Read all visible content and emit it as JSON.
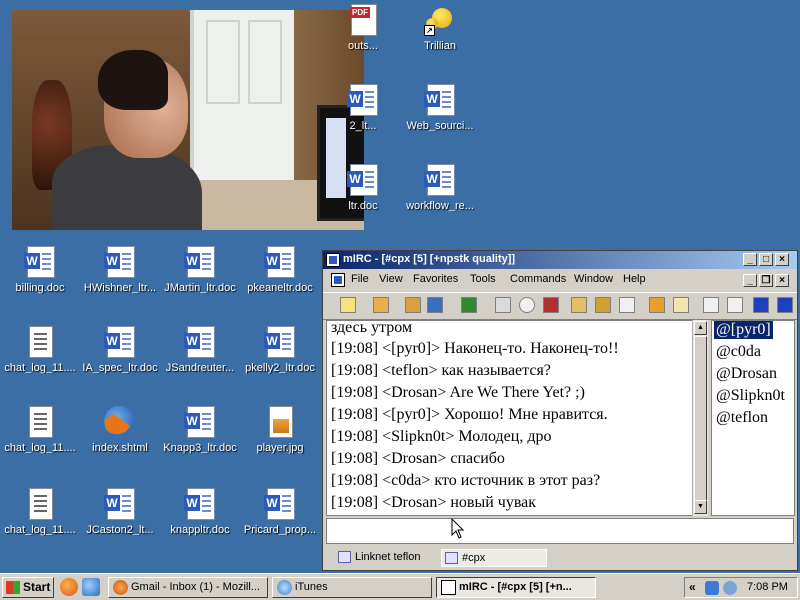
{
  "desktop": {
    "icons": [
      {
        "label": "outs...",
        "type": "pdf"
      },
      {
        "label": "Trillian",
        "type": "trillian"
      },
      {
        "label": "2_lt...",
        "type": "word"
      },
      {
        "label": "Web_sourci...",
        "type": "word"
      },
      {
        "label": "ltr.doc",
        "type": "word"
      },
      {
        "label": "workflow_re...",
        "type": "word"
      },
      {
        "label": "billing.doc",
        "type": "word"
      },
      {
        "label": "HWishner_ltr...",
        "type": "word"
      },
      {
        "label": "JMartin_ltr.doc",
        "type": "word"
      },
      {
        "label": "pkeaneltr.doc",
        "type": "word"
      },
      {
        "label": "chat_log_11....",
        "type": "txt"
      },
      {
        "label": "IA_spec_ltr.doc",
        "type": "word"
      },
      {
        "label": "JSandreuter...",
        "type": "word"
      },
      {
        "label": "pkelly2_ltr.doc",
        "type": "word"
      },
      {
        "label": "chat_log_11....",
        "type": "txt"
      },
      {
        "label": "index.shtml",
        "type": "firefox"
      },
      {
        "label": "Knapp3_ltr.doc",
        "type": "word"
      },
      {
        "label": "player.jpg",
        "type": "jpg"
      },
      {
        "label": "chat_log_11....",
        "type": "txt"
      },
      {
        "label": "JCaston2_lt...",
        "type": "word"
      },
      {
        "label": "knappltr.doc",
        "type": "word"
      },
      {
        "label": "Pricard_prop...",
        "type": "word"
      }
    ]
  },
  "mirc": {
    "title": "mIRC - [#cpx [5] [+npstk quality]]",
    "menu": [
      "File",
      "View",
      "Favorites",
      "Tools",
      "Commands",
      "Window",
      "Help"
    ],
    "chat_lines": [
      "здесь утром",
      "[19:08] <[pyr0]> Наконец-то. Наконец-то!!",
      "[19:08] <teflon> как называется?",
      "[19:08] <Drosan> Are We There Yet? ;)",
      "[19:08] <[pyr0]> Хорошо! Мне нравится.",
      "[19:08] <Slipkn0t> Молодец, дро",
      "[19:08] <Drosan> спасибо",
      "[19:08] <c0da> кто источник в этот раз?",
      "[19:08] <Drosan> новый чувак"
    ],
    "nicks": [
      "@[pyr0]",
      "@c0da",
      "@Drosan",
      "@Slipkn0t",
      "@teflon"
    ],
    "selected_nick": "@[pyr0]",
    "input_value": "",
    "switchbar": [
      {
        "label": "Linknet teflon",
        "active": false
      },
      {
        "label": "#cpx",
        "active": true
      }
    ]
  },
  "taskbar": {
    "start_label": "Start",
    "buttons": [
      {
        "label": "Gmail - Inbox (1) - Mozill...",
        "active": false
      },
      {
        "label": "iTunes",
        "active": false
      },
      {
        "label": "mIRC - [#cpx [5] [+n...",
        "active": true
      }
    ],
    "clock": "7:08 PM",
    "tray_chevron": "«"
  },
  "colors": {
    "desktop_bg": "#3a6ea5",
    "title_active": "#0a246a",
    "face": "#d4d0c8"
  }
}
